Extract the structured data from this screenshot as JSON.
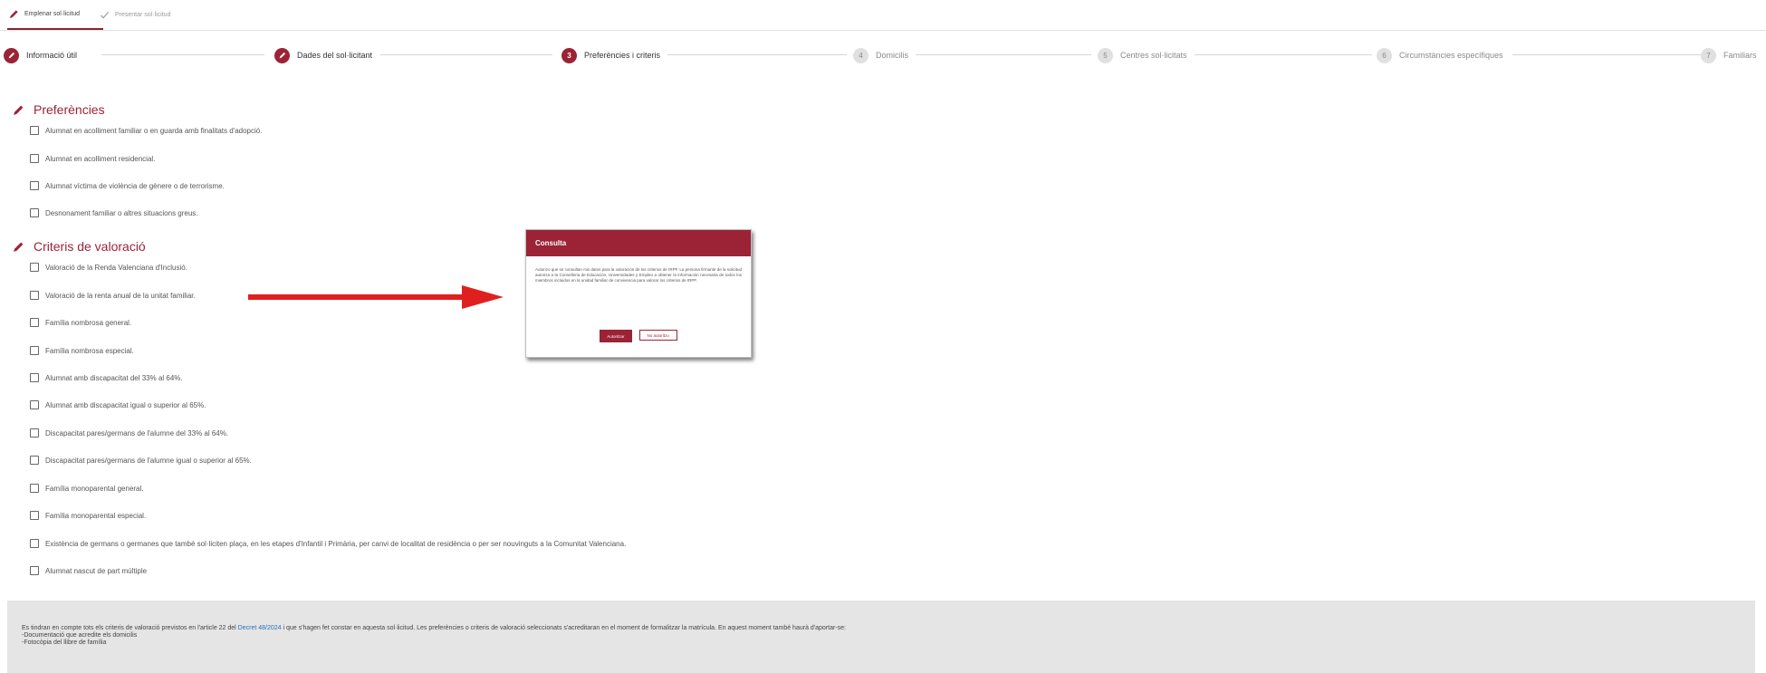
{
  "top_tabs": {
    "fill": "Emplenar sol·licitud",
    "submit": "Presentar sol·licitud"
  },
  "steps": [
    {
      "num": "",
      "label": "Informació útil",
      "state": "done"
    },
    {
      "num": "",
      "label": "Dades del sol·licitant",
      "state": "done"
    },
    {
      "num": "3",
      "label": "Preferències i criteris",
      "state": "current"
    },
    {
      "num": "4",
      "label": "Domicilis",
      "state": "todo"
    },
    {
      "num": "5",
      "label": "Centres sol·licitats",
      "state": "todo"
    },
    {
      "num": "6",
      "label": "Circumstàncies específiques",
      "state": "todo"
    },
    {
      "num": "7",
      "label": "Familiars",
      "state": "todo"
    }
  ],
  "preferences": {
    "title": "Preferències",
    "options": [
      "Alumnat en acolliment familiar o en guarda amb finalitats d'adopció.",
      "Alumnat en acolliment residencial.",
      "Alumnat víctima de violència de gènere o de terrorisme.",
      "Desnonament familiar o altres situacions greus."
    ]
  },
  "criteria": {
    "title": "Criteris de valoració",
    "options": [
      "Valoració de la Renda Valenciana d'Inclusió.",
      "Valoració de la renta anual de la unitat familiar.",
      "Família nombrosa general.",
      "Família nombrosa especial.",
      "Alumnat amb discapacitat del 33% al 64%.",
      "Alumnat amb discapacitat igual o superior al 65%.",
      "Discapacitat pares/germans de l'alumne del 33% al 64%.",
      "Discapacitat pares/germans de l'alumne igual o superior al 65%.",
      "Família monoparental general.",
      "Família monoparental especial.",
      "Existència de germans o germanes que també sol·liciten plaça, en les etapes d'Infantil i Primària, per canvi de localitat de residència o per ser nouvinguts a la Comunitat Valenciana.",
      "Alumnat nascut de part múltiple"
    ]
  },
  "modal": {
    "title": "Consulta",
    "body": "Autorizo que se consultan mis datos para la valoración de los criterios de IRPF. La persona firmante de la solicitud autoriza a la Conselleria de Educación, Universidades y Empleo a obtener la información necesaria de todos los miembros incluidos en la unidad familiar de convivencia para valorar los criterios de IRPF.",
    "authorize": "Autoritzar",
    "no_authorize": "No autoritzo"
  },
  "footer": {
    "line1_before": "Es tindran en compte tots els criteris de valoració previstos en l'article 22 del ",
    "line1_link": "Decret 48/2024",
    "line1_after": " i que s'hagen fet constar en aquesta sol·licitud. Les preferències o criteris de valoració seleccionats s'acreditaran en el moment de formalitzar la matrícula. En aquest moment també haurà d'aportar-se:",
    "line2": "-Documentació que acredite els domicilis",
    "line3": "-Fotocòpia del llibre de família"
  },
  "colors": {
    "accent": "#9b2335",
    "arrow": "#e0201f",
    "footer_bg": "#e5e5e5",
    "link": "#2a6ebb"
  }
}
